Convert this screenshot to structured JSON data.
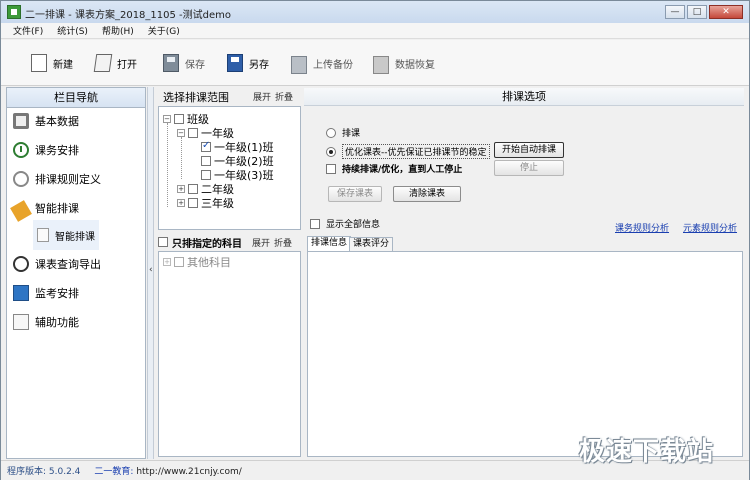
{
  "window": {
    "title": "二一排课 - 课表方案_2018_1105 -测试demo",
    "controls": {
      "minimize": "—",
      "maximize": "□",
      "close": "✕"
    }
  },
  "menu": [
    "文件(F)",
    "统计(S)",
    "帮助(H)",
    "关于(G)"
  ],
  "toolbar": [
    {
      "label": "新建",
      "icon": "new-file-icon",
      "enabled": true
    },
    {
      "label": "打开",
      "icon": "open-folder-icon",
      "enabled": true
    },
    {
      "label": "保存",
      "icon": "save-icon",
      "enabled": false
    },
    {
      "label": "另存",
      "icon": "save-as-icon",
      "enabled": true
    },
    {
      "label": "上传备份",
      "icon": "upload-backup-icon",
      "enabled": false
    },
    {
      "label": "数据恢复",
      "icon": "data-restore-icon",
      "enabled": false
    }
  ],
  "nav": {
    "header": "栏目导航",
    "items": [
      {
        "label": "基本数据",
        "icon": "basic-data-icon"
      },
      {
        "label": "课务安排",
        "icon": "course-arrangement-icon"
      },
      {
        "label": "排课规则定义",
        "icon": "rule-definition-icon"
      },
      {
        "label": "智能排课",
        "icon": "smart-scheduling-icon"
      },
      {
        "label": "课表查询导出",
        "icon": "schedule-query-icon"
      },
      {
        "label": "监考安排",
        "icon": "exam-monitor-icon"
      },
      {
        "label": "辅助功能",
        "icon": "auxiliary-icon"
      }
    ],
    "sub_item": {
      "label": "智能排课",
      "icon": "document-icon",
      "selected": true
    }
  },
  "range_panel": {
    "title": "选择排课范围",
    "expand": "展开",
    "collapse": "折叠",
    "tree": {
      "root": "班级",
      "grade1": "一年级",
      "classes": [
        {
          "label": "一年级(1)班",
          "checked": true
        },
        {
          "label": "一年级(2)班",
          "checked": false
        },
        {
          "label": "一年级(3)班",
          "checked": false
        }
      ],
      "grade2": "二年级",
      "grade3": "三年级"
    }
  },
  "subject_panel": {
    "checkbox_label": "只排指定的科目",
    "expand": "展开",
    "collapse": "折叠",
    "other": "其他科目"
  },
  "options": {
    "title": "排课选项",
    "radio_schedule": "排课",
    "radio_optimize": "优化课表--优先保证已排课节的稳定",
    "continuous": "持续排课/优化，直到人工停止",
    "start_button": "开始自动排课",
    "stop_button": "停止",
    "save_button": "保存课表",
    "clear_button": "清除课表",
    "show_all": "显示全部信息",
    "link_task": "课务规则分析",
    "link_element": "元素规则分析",
    "tabs": [
      "排课信息",
      "课表评分"
    ]
  },
  "status": {
    "version": "程序版本: 5.0.2.4",
    "edu_label": "二一教育:",
    "url": "http://www.21cnjy.com/"
  },
  "watermark": "极速下载站"
}
